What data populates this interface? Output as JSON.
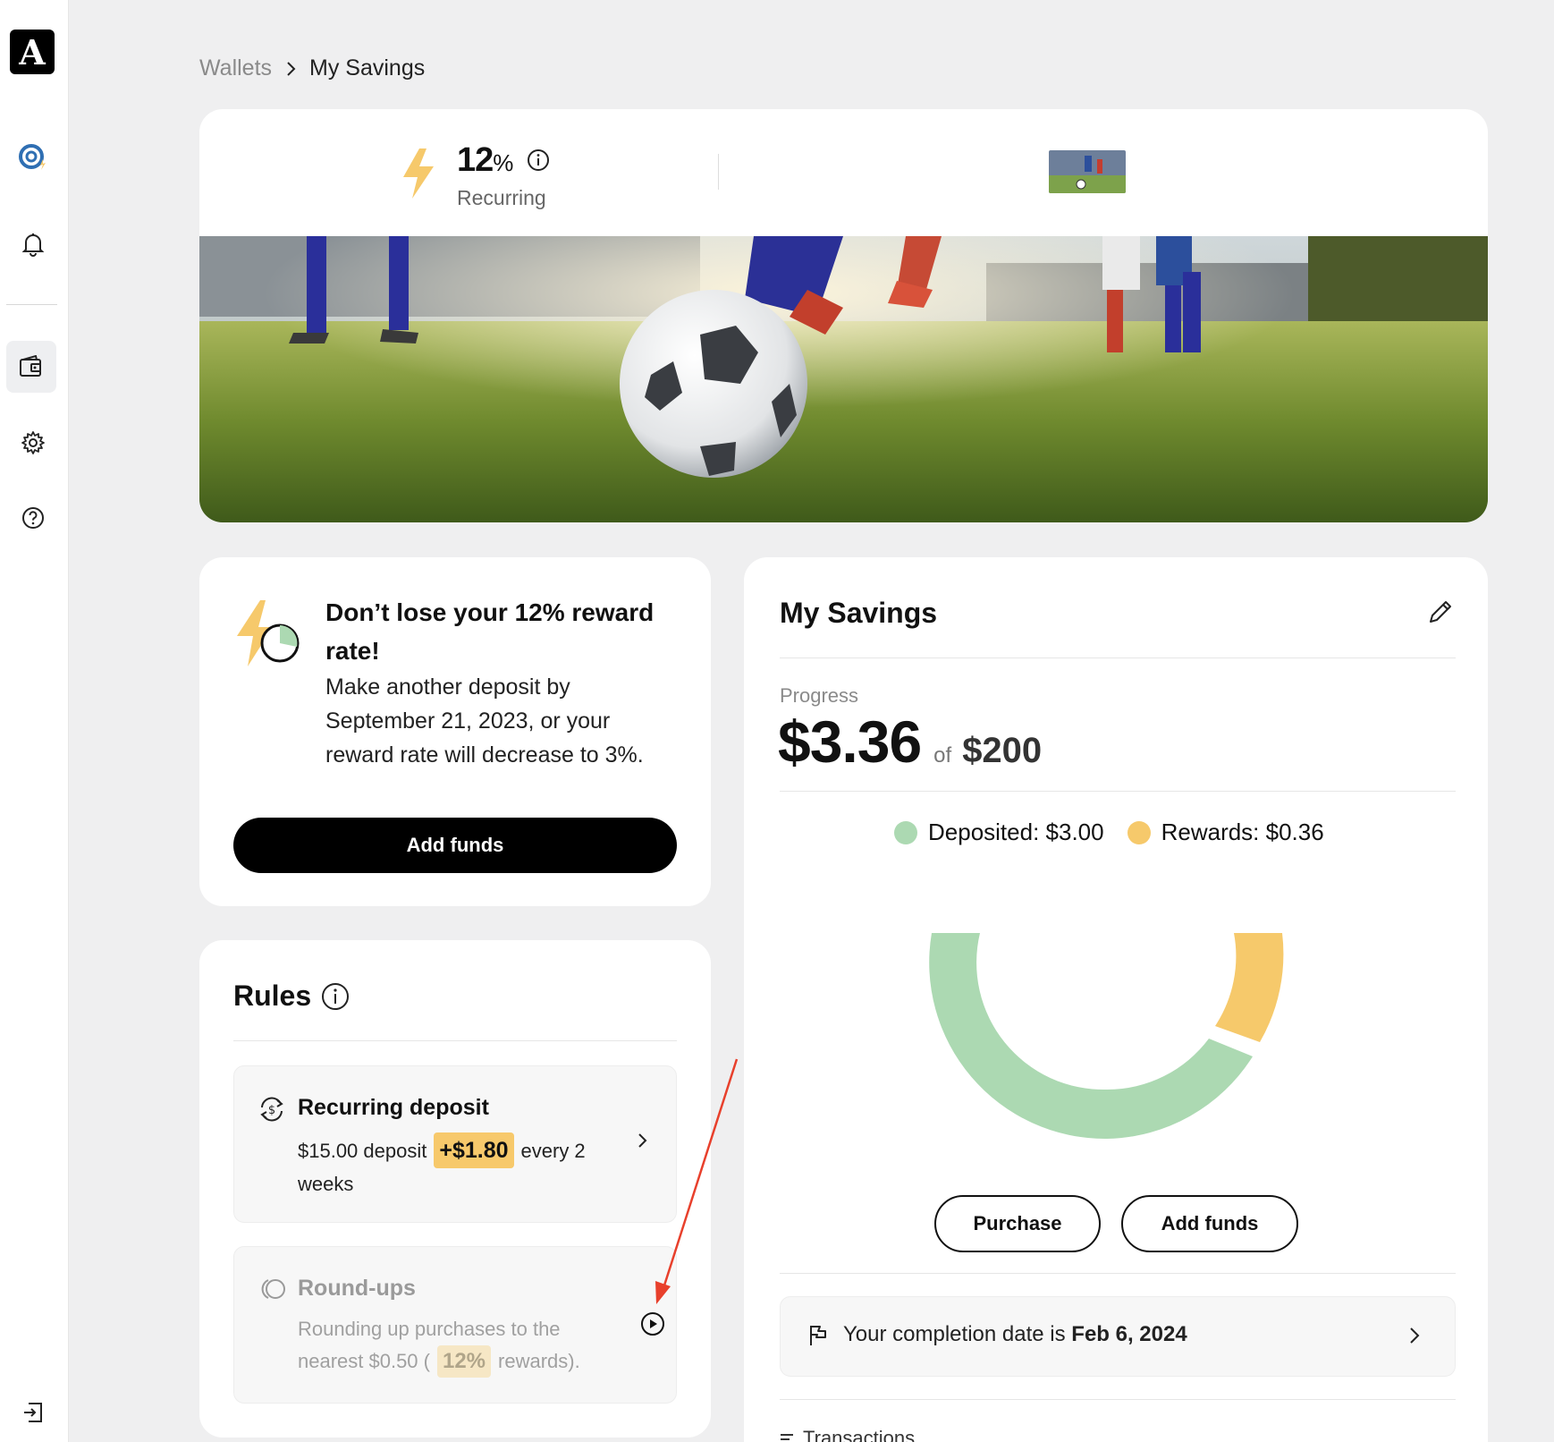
{
  "sidebar": {
    "logo_letter": "A",
    "items": [
      {
        "name": "rewards",
        "icon": "rewards-icon"
      },
      {
        "name": "notifications",
        "icon": "bell-icon"
      },
      {
        "name": "wallets",
        "icon": "wallet-icon",
        "active": true
      },
      {
        "name": "settings",
        "icon": "gear-icon"
      },
      {
        "name": "help",
        "icon": "help-icon"
      },
      {
        "name": "logout",
        "icon": "logout-icon"
      }
    ]
  },
  "breadcrumb": {
    "root": "Wallets",
    "current": "My Savings"
  },
  "hero": {
    "rate_value": "12",
    "rate_unit": "%",
    "rate_label": "Recurring"
  },
  "warning": {
    "title": "Don’t lose your 12% reward rate!",
    "body": "Make another deposit by September 21, 2023, or your reward rate will decrease to 3%.",
    "button": "Add funds"
  },
  "rules": {
    "title": "Rules",
    "items": [
      {
        "title": "Recurring deposit",
        "body_pre": "$15.00 deposit",
        "highlight": "+$1.80",
        "body_post": "every 2 weeks",
        "enabled": true
      },
      {
        "title": "Round-ups",
        "body_pre": "Rounding up purchases to the nearest $0.50 (",
        "highlight": "12%",
        "body_post": "rewards).",
        "enabled": false
      }
    ]
  },
  "savings": {
    "title": "My Savings",
    "progress_label": "Progress",
    "amount": "$3.36",
    "of": "of",
    "goal": "$200",
    "legend": [
      {
        "label": "Deposited: $3.00",
        "color": "#acd9b2"
      },
      {
        "label": "Rewards: $0.36",
        "color": "#f6c96b"
      }
    ],
    "buttons": {
      "purchase": "Purchase",
      "add_funds": "Add funds"
    },
    "completion": {
      "prefix": "Your completion date is",
      "date": "Feb 6, 2024"
    },
    "transactions_label": "Transactions"
  },
  "colors": {
    "accent_yellow": "#f6c96b",
    "deposit_green": "#acd9b2",
    "annotation_red": "#e8402c"
  }
}
